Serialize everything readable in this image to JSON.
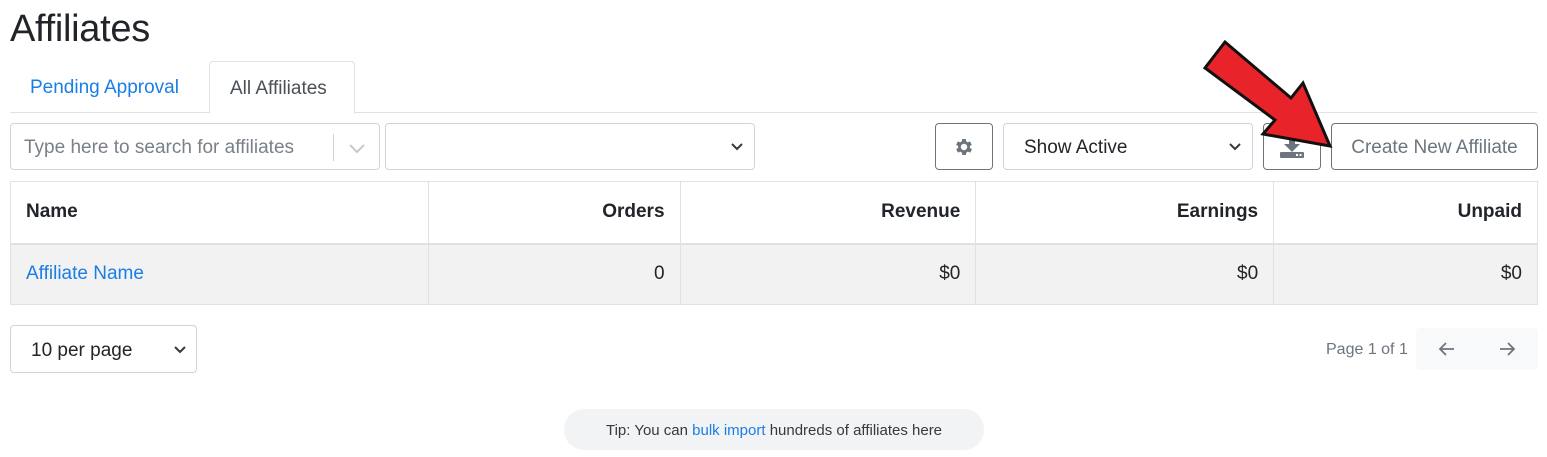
{
  "page": {
    "title": "Affiliates"
  },
  "tabs": [
    {
      "label": "Pending Approval",
      "active": false
    },
    {
      "label": "All Affiliates",
      "active": true
    }
  ],
  "toolbar": {
    "search_placeholder": "Type here to search for affiliates",
    "filter_value": "",
    "status_filter": "Show Active",
    "create_label": "Create New Affiliate",
    "icons": {
      "settings": "gear-icon",
      "export": "download-icon"
    }
  },
  "table": {
    "headers": {
      "name": "Name",
      "orders": "Orders",
      "revenue": "Revenue",
      "earnings": "Earnings",
      "unpaid": "Unpaid"
    },
    "rows": [
      {
        "name": "Affiliate Name",
        "orders": "0",
        "revenue": "$0",
        "earnings": "$0",
        "unpaid": "$0"
      }
    ]
  },
  "pagination": {
    "per_page": "10 per page",
    "page_info": "Page 1 of 1"
  },
  "tip": {
    "prefix": "Tip: You can",
    "link": "bulk import",
    "suffix": "hundreds of affiliates here"
  },
  "colors": {
    "link": "#1a7ee5",
    "annotation_arrow": "#e8242a"
  }
}
